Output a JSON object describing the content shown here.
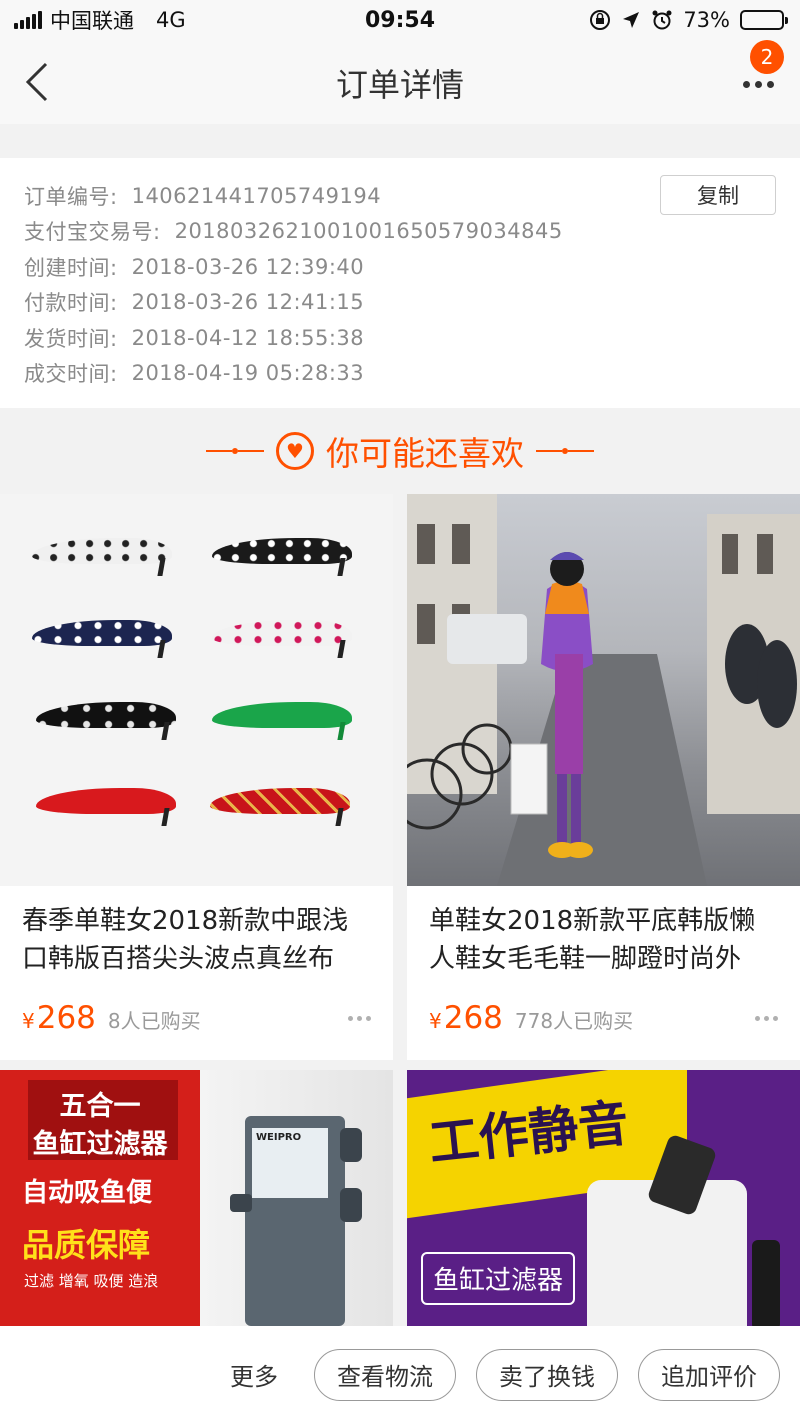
{
  "status_bar": {
    "carrier": "中国联通",
    "network": "4G",
    "time": "09:54",
    "battery_text": "73%",
    "battery_level": 0.73
  },
  "nav": {
    "title": "订单详情",
    "badge_count": "2"
  },
  "order_info": {
    "copy_label": "复制",
    "rows": [
      {
        "label": "订单编号:",
        "value": "140621441705749194"
      },
      {
        "label": "支付宝交易号:",
        "value": "2018032621001001650579034845"
      },
      {
        "label": "创建时间:",
        "value": "2018-03-26 12:39:40"
      },
      {
        "label": "付款时间:",
        "value": "2018-03-26 12:41:15"
      },
      {
        "label": "发货时间:",
        "value": "2018-04-12 18:55:38"
      },
      {
        "label": "成交时间:",
        "value": "2018-04-19 05:28:33"
      }
    ]
  },
  "recommend": {
    "title": "你可能还喜欢",
    "products": [
      {
        "title": "春季单鞋女2018新款中跟浅口韩版百搭尖头波点真丝布",
        "price_symbol": "¥",
        "price": "268",
        "sold": "8人已购买"
      },
      {
        "title": "单鞋女2018新款平底韩版懒人鞋女毛毛鞋一脚蹬时尚外",
        "price_symbol": "¥",
        "price": "268",
        "sold": "778人已购买"
      }
    ],
    "ads": [
      {
        "line1": "五合一",
        "line2": "鱼缸过滤器",
        "line3": "自动吸鱼便",
        "line4": "品质保障",
        "line5": "过滤  增氧  吸便  造浪",
        "brand": "WEIPRO"
      },
      {
        "headline": "工作静音",
        "subline": "鱼缸过滤器"
      }
    ]
  },
  "bottom_bar": {
    "more": "更多",
    "logistics": "查看物流",
    "sell": "卖了换钱",
    "review": "追加评价"
  },
  "colors": {
    "accent": "#ff5000",
    "label_gray": "#8a8a8a"
  }
}
